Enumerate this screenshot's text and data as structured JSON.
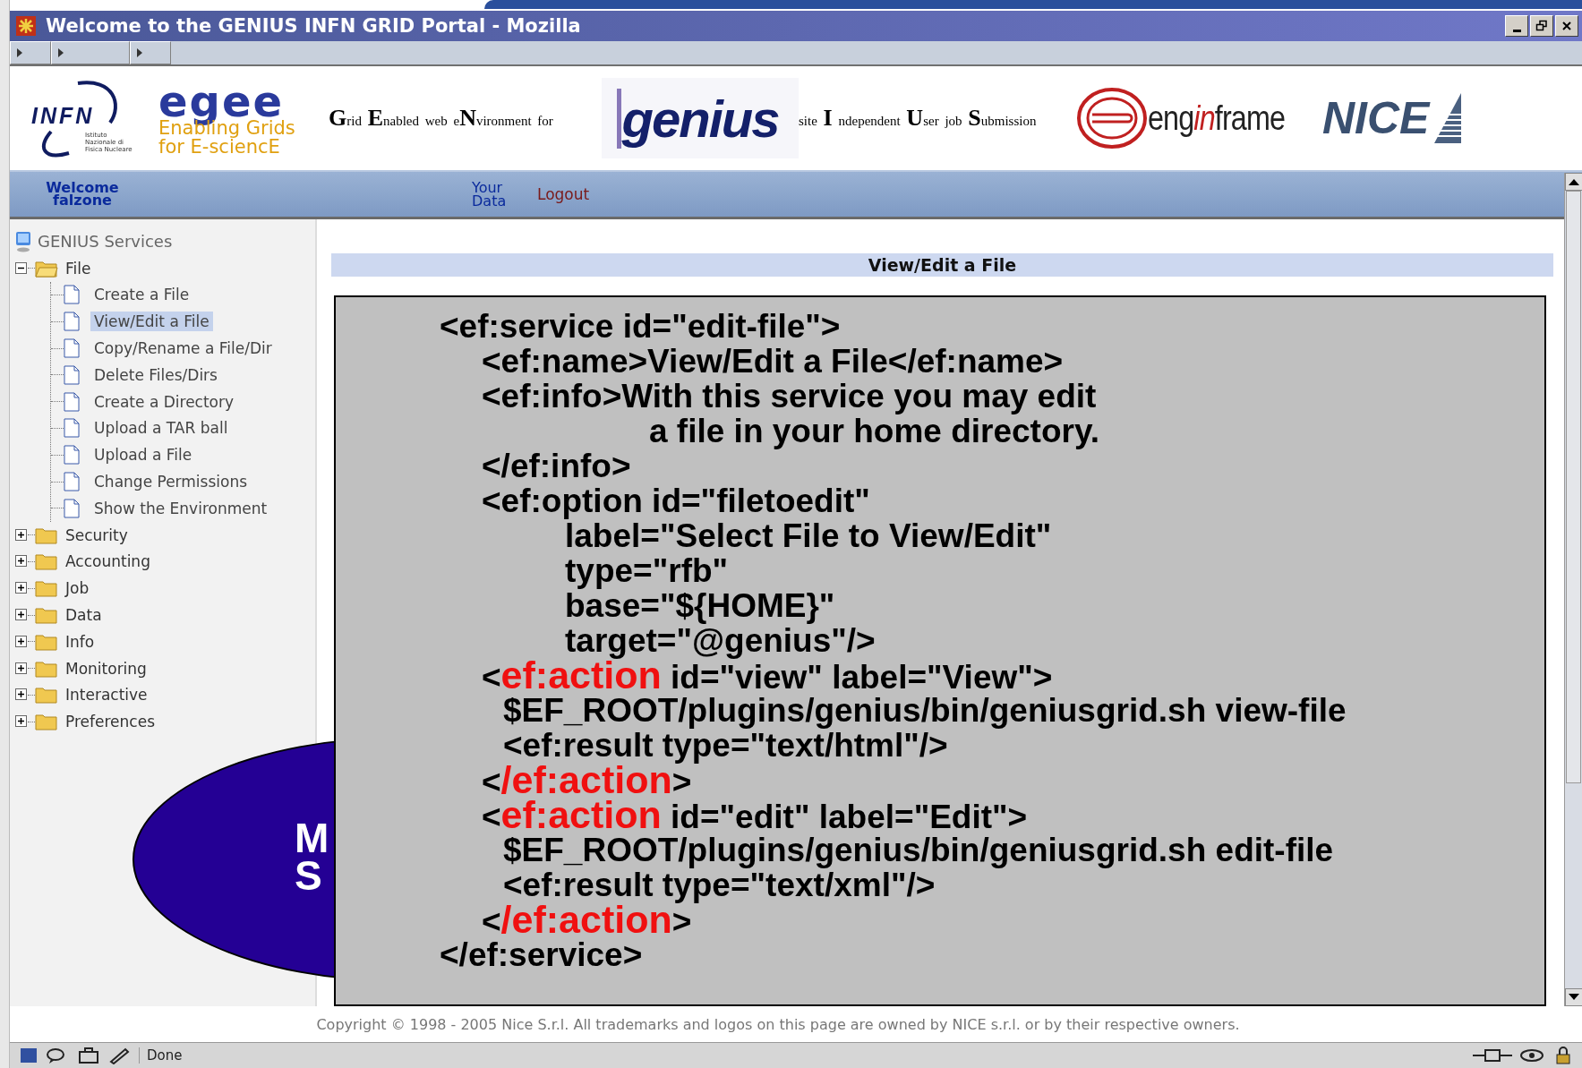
{
  "window": {
    "title": "Welcome to the GENIUS INFN GRID Portal - Mozilla"
  },
  "banner": {
    "infn": "INFN",
    "infn_sub": "Istituto Nazionale di Fisica Nucleare",
    "egee": "egee",
    "egee_line1": "Enabling Grids",
    "egee_line2": "for E-sciencE",
    "genius_tagline": "**G**rid **E**nabled web e**N**vironment for",
    "genius": "genius",
    "ius_tagline": "site **I** ndependent **U**ser job **S**ubmission",
    "enginframe": {
      "before": "eng",
      "accent": "in",
      "after": "frame"
    },
    "nice": "NICE"
  },
  "nav": {
    "welcome": "Welcome",
    "user": "falzone",
    "your_data": [
      "Your",
      "Data"
    ],
    "logout": "Logout"
  },
  "sidebar": {
    "root": "GENIUS Services",
    "items": [
      {
        "label": "File",
        "expanded": true,
        "children": [
          {
            "label": "Create a File",
            "selected": false
          },
          {
            "label": "View/Edit a File",
            "selected": true
          },
          {
            "label": "Copy/Rename a File/Dir",
            "selected": false
          },
          {
            "label": "Delete Files/Dirs",
            "selected": false
          },
          {
            "label": "Create a Directory",
            "selected": false
          },
          {
            "label": "Upload a TAR ball",
            "selected": false
          },
          {
            "label": "Upload a File",
            "selected": false
          },
          {
            "label": "Change Permissions",
            "selected": false
          },
          {
            "label": "Show the Environment",
            "selected": false
          }
        ]
      },
      {
        "label": "Security",
        "expanded": false
      },
      {
        "label": "Accounting",
        "expanded": false
      },
      {
        "label": "Job",
        "expanded": false
      },
      {
        "label": "Data",
        "expanded": false
      },
      {
        "label": "Info",
        "expanded": false
      },
      {
        "label": "Monitoring",
        "expanded": false
      },
      {
        "label": "Interactive",
        "expanded": false
      },
      {
        "label": "Preferences",
        "expanded": false
      }
    ]
  },
  "content": {
    "heading": "View/Edit a File"
  },
  "slide_overlay": {
    "ellipse_text": [
      "M",
      "S"
    ],
    "code_lines": [
      {
        "kind": "root",
        "parts": [
          {
            "kind": "plain",
            "text": "<ef:service id=\"edit-file\">"
          }
        ]
      },
      {
        "kind": "tag",
        "parts": [
          {
            "kind": "plain",
            "text": "<ef:name>View/Edit a File</ef:name>"
          }
        ]
      },
      {
        "kind": "tag",
        "parts": [
          {
            "kind": "plain",
            "text": "<ef:info>With this service you may edit"
          }
        ]
      },
      {
        "kind": "wrap",
        "parts": [
          {
            "kind": "plain",
            "text": "a file in your home directory."
          }
        ]
      },
      {
        "kind": "tag",
        "parts": [
          {
            "kind": "plain",
            "text": "</ef:info>"
          }
        ]
      },
      {
        "kind": "tag",
        "parts": [
          {
            "kind": "plain",
            "text": "<ef:option id=\"filetoedit\""
          }
        ]
      },
      {
        "kind": "attr",
        "parts": [
          {
            "kind": "plain",
            "text": "label=\"Select File to View/Edit\""
          }
        ]
      },
      {
        "kind": "attr",
        "parts": [
          {
            "kind": "plain",
            "text": "type=\"rfb\""
          }
        ]
      },
      {
        "kind": "attr",
        "parts": [
          {
            "kind": "plain",
            "text": "base=\"${HOME}\""
          }
        ]
      },
      {
        "kind": "attr",
        "parts": [
          {
            "kind": "plain",
            "text": "target=\"@genius\"/>"
          }
        ]
      },
      {
        "kind": "tag",
        "parts": [
          {
            "kind": "plain",
            "text": "<"
          },
          {
            "kind": "highlight",
            "text": "ef:action"
          },
          {
            "kind": "plain",
            "text": " id=\"view\" label=\"View\">"
          }
        ]
      },
      {
        "kind": "content",
        "parts": [
          {
            "kind": "plain",
            "text": "$EF_ROOT/plugins/genius/bin/geniusgrid.sh view-file"
          }
        ]
      },
      {
        "kind": "content",
        "parts": [
          {
            "kind": "plain",
            "text": "<ef:result type=\"text/html\"/>"
          }
        ]
      },
      {
        "kind": "tag",
        "parts": [
          {
            "kind": "plain",
            "text": "<"
          },
          {
            "kind": "highlight",
            "text": "/ef:action"
          },
          {
            "kind": "plain",
            "text": ">"
          }
        ]
      },
      {
        "kind": "tag",
        "parts": [
          {
            "kind": "plain",
            "text": "<"
          },
          {
            "kind": "highlight",
            "text": "ef:action"
          },
          {
            "kind": "plain",
            "text": " id=\"edit\" label=\"Edit\">"
          }
        ]
      },
      {
        "kind": "content",
        "parts": [
          {
            "kind": "plain",
            "text": "$EF_ROOT/plugins/genius/bin/geniusgrid.sh edit-file"
          }
        ]
      },
      {
        "kind": "content",
        "parts": [
          {
            "kind": "plain",
            "text": "<ef:result type=\"text/xml\"/>"
          }
        ]
      },
      {
        "kind": "tag",
        "parts": [
          {
            "kind": "plain",
            "text": "<"
          },
          {
            "kind": "highlight",
            "text": "/ef:action"
          },
          {
            "kind": "plain",
            "text": ">"
          }
        ]
      },
      {
        "kind": "root",
        "parts": [
          {
            "kind": "plain",
            "text": "</ef:service>"
          }
        ]
      }
    ]
  },
  "footer": {
    "copyright": "Copyright © 1998 - 2005 Nice S.r.l. All trademarks and logos on this page are owned by NICE s.r.l. or by their respective owners."
  },
  "status_bar": {
    "text": "Done"
  }
}
